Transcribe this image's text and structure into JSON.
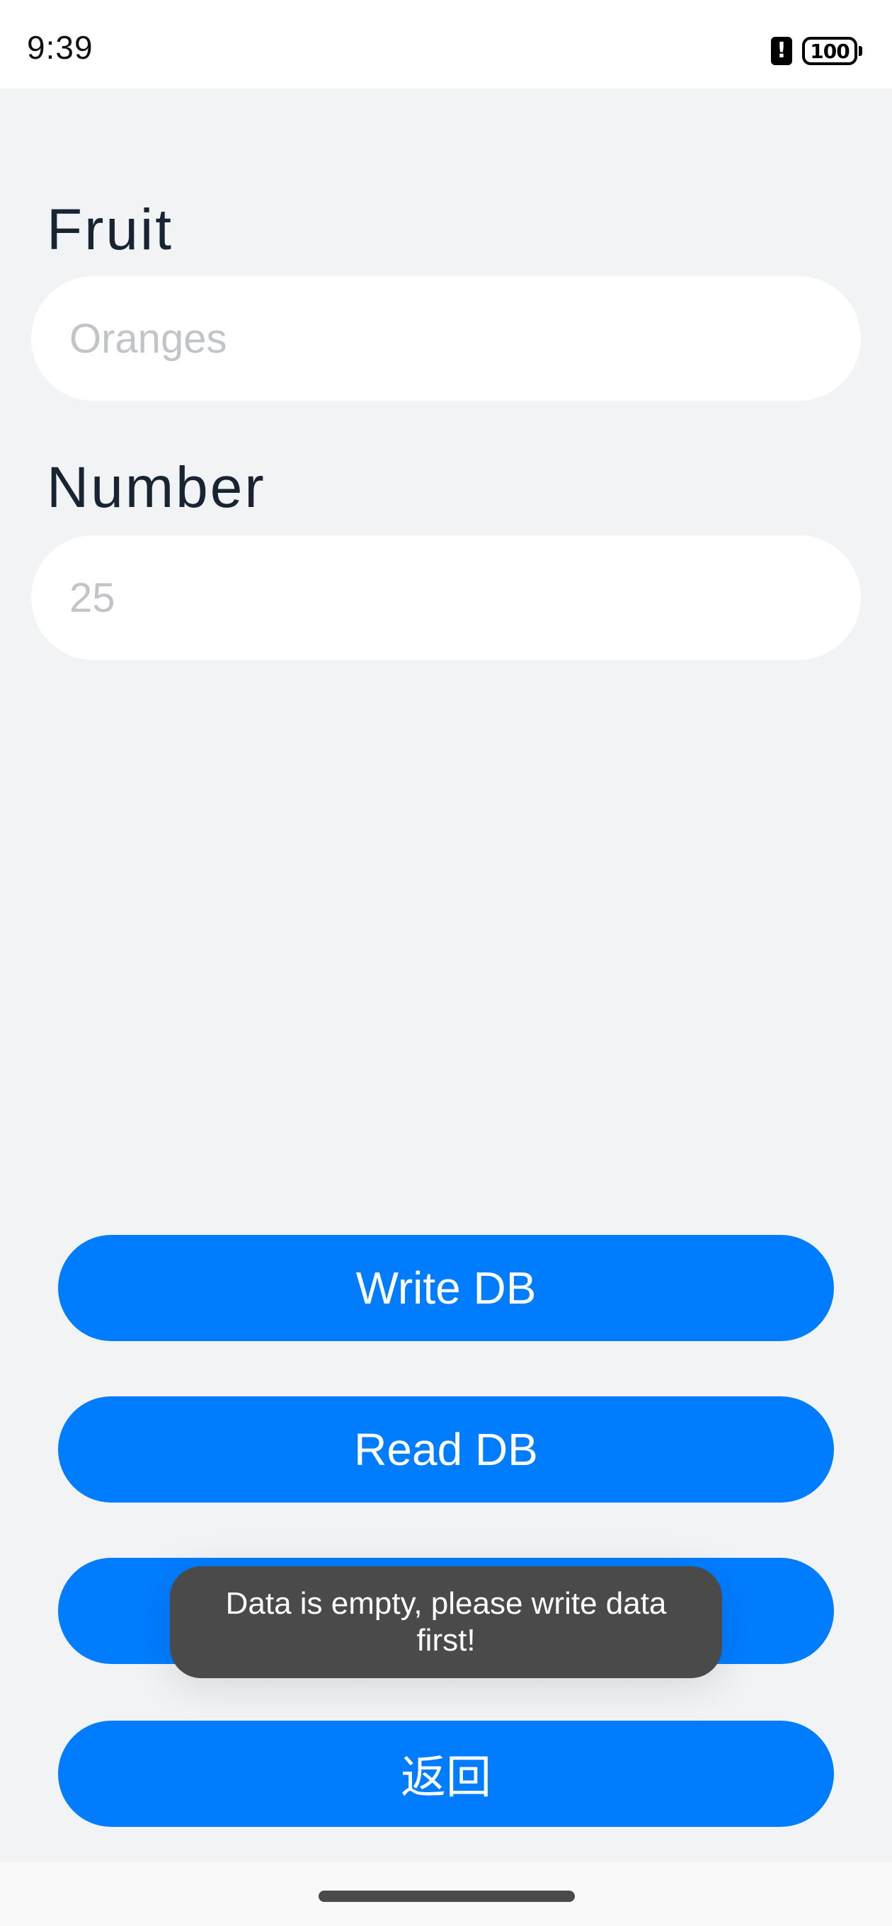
{
  "status_bar": {
    "time": "9:39",
    "battery": "100",
    "icons": [
      "alert-icon",
      "battery-icon"
    ]
  },
  "form": {
    "fruit_label": "Fruit",
    "fruit_placeholder": "Oranges",
    "number_label": "Number",
    "number_placeholder": "25"
  },
  "buttons": {
    "write": "Write DB",
    "read": "Read DB",
    "back": "返回"
  },
  "toast": {
    "message": "Data is empty, please write data first!"
  },
  "colors": {
    "accent": "#007dff",
    "background": "#f1f3f5",
    "toast": "#4a4a4a"
  }
}
